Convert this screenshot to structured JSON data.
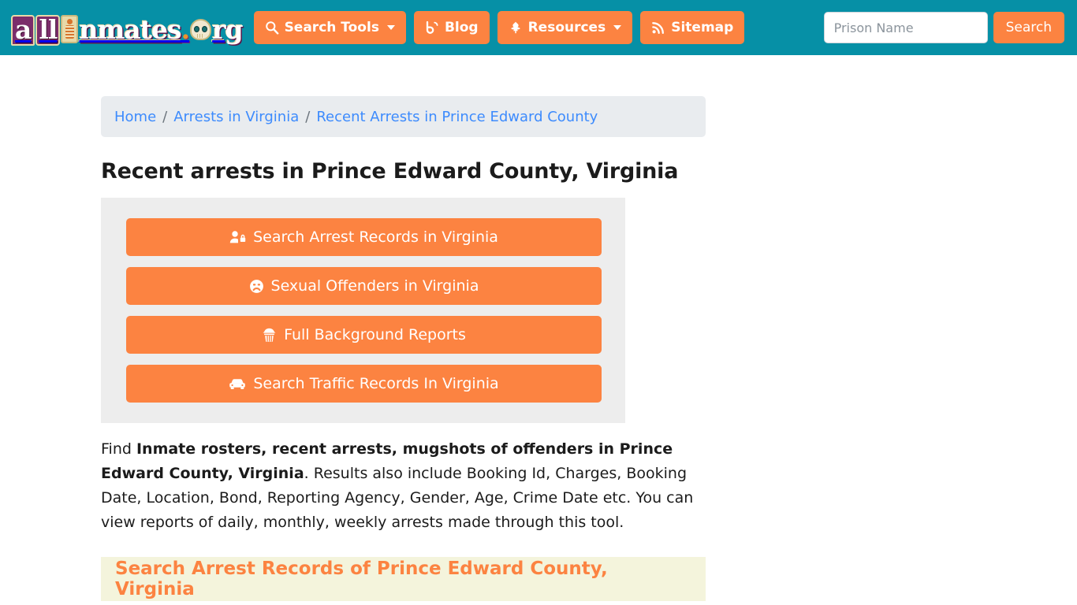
{
  "header": {
    "logo": {
      "part_a": "a",
      "part_ll": "ll",
      "badge_icon": "inmate-figure-icon",
      "part_rest": "nmates",
      "dot": ".",
      "skull_icon": "skull-icon",
      "part_org": "rg",
      "alt": "allInmates.org"
    },
    "nav": [
      {
        "label": "Search Tools",
        "icon": "search-icon",
        "has_caret": true
      },
      {
        "label": "Blog",
        "icon": "blog-icon",
        "has_caret": false
      },
      {
        "label": "Resources",
        "icon": "leaf-icon",
        "has_caret": true
      },
      {
        "label": "Sitemap",
        "icon": "rss-icon",
        "has_caret": false
      }
    ],
    "search": {
      "placeholder": "Prison Name",
      "value": "",
      "button_label": "Search"
    }
  },
  "breadcrumb": [
    {
      "label": "Home",
      "is_link": true
    },
    {
      "label": "Arrests in Virginia",
      "is_link": true
    },
    {
      "label": "Recent Arrests in Prince Edward County",
      "is_link": true
    }
  ],
  "breadcrumb_separator": "/",
  "main": {
    "page_title": "Recent arrests in Prince Edward County, Virginia",
    "action_buttons": [
      {
        "label": "Search Arrest Records in Virginia",
        "icon": "user-lock-icon"
      },
      {
        "label": "Sexual Offenders in Virginia",
        "icon": "frowning-face-icon"
      },
      {
        "label": "Full Background Reports",
        "icon": "detective-icon"
      },
      {
        "label": "Search Traffic Records In Virginia",
        "icon": "car-icon"
      }
    ],
    "lead_paragraph": {
      "text_1": "Find ",
      "bold_1": "Inmate rosters, recent arrests, mugshots of offenders in Prince Edward County, Virginia",
      "text_2": ". Results also include Booking Id, Charges, Booking Date, Location, Bond, Reporting Agency, Gender, Age, Crime Date etc. You can view reports of daily, monthly, weekly arrests made through this tool."
    },
    "section_heading": "Search Arrest Records of Prince Edward County, Virginia"
  },
  "colors": {
    "header_teal": "#0690a6",
    "accent_orange": "#fc8341",
    "panel_gray": "#ededed",
    "breadcrumb_gray": "#e9ecef",
    "link_blue": "#3d8bfd",
    "highlight_yellow": "#f4f4dc"
  }
}
